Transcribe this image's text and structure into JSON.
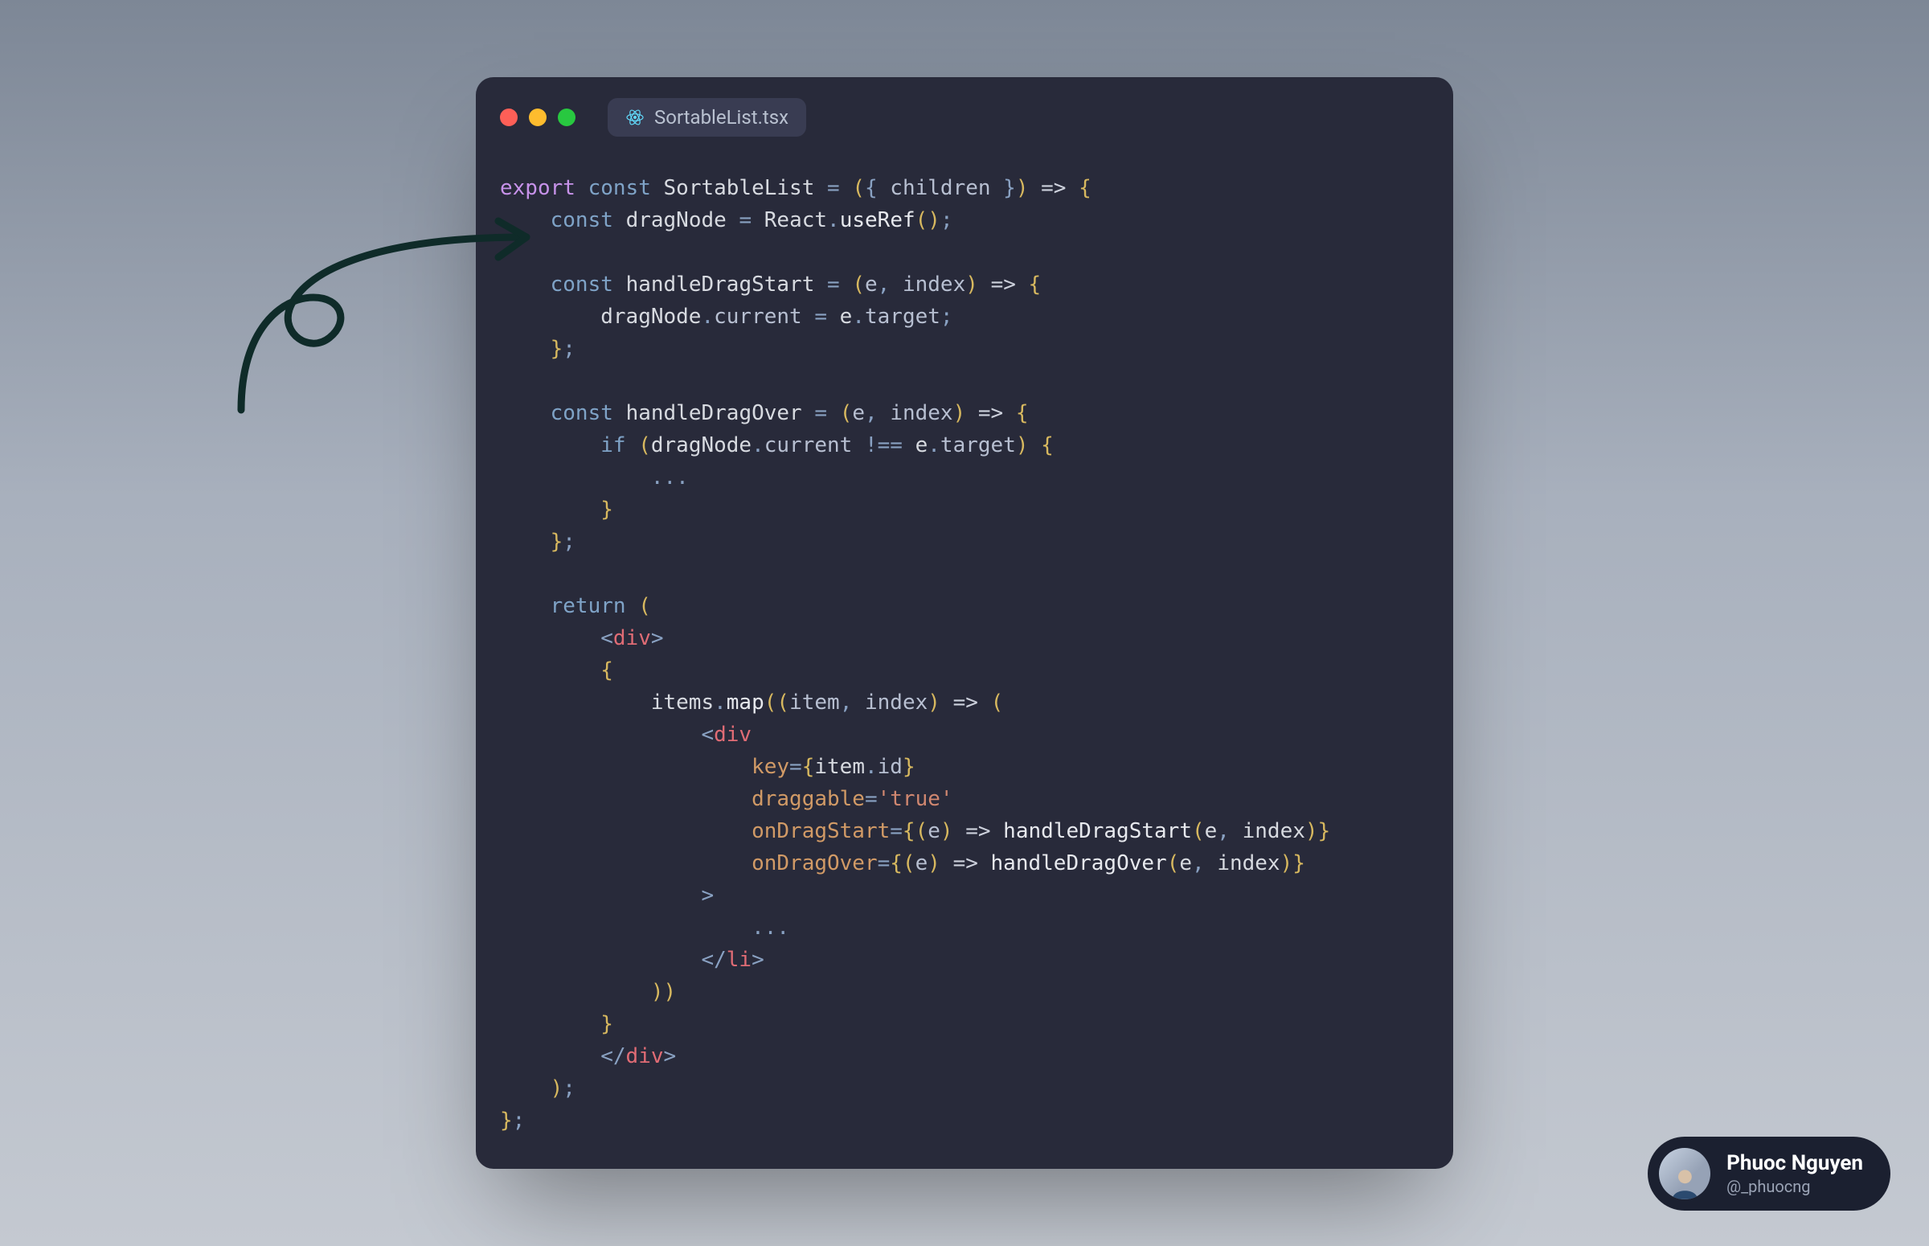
{
  "window": {
    "tab": {
      "label": "SortableList.tsx",
      "icon": "react-icon"
    }
  },
  "code": {
    "tokens": [
      [
        [
          "k1",
          "export"
        ],
        [
          "",
          " "
        ],
        [
          "k2",
          "const"
        ],
        [
          "",
          " "
        ],
        [
          "nm",
          "SortableList"
        ],
        [
          "",
          " "
        ],
        [
          "pn",
          "="
        ],
        [
          "",
          " "
        ],
        [
          "pr",
          "("
        ],
        [
          "pn",
          "{ "
        ],
        [
          "pp",
          "children"
        ],
        [
          "pn",
          " }"
        ],
        [
          "pr",
          ")"
        ],
        [
          "",
          " "
        ],
        [
          "ar",
          "=>"
        ],
        [
          "",
          " "
        ],
        [
          "pr",
          "{"
        ]
      ],
      [
        [
          "",
          "    "
        ],
        [
          "k2",
          "const"
        ],
        [
          "",
          " "
        ],
        [
          "nm",
          "dragNode"
        ],
        [
          "",
          " "
        ],
        [
          "pn",
          "="
        ],
        [
          "",
          " "
        ],
        [
          "nm",
          "React"
        ],
        [
          "pn",
          "."
        ],
        [
          "fn",
          "useRef"
        ],
        [
          "pr",
          "()"
        ],
        [
          "pn",
          ";"
        ]
      ],
      [
        [
          "",
          ""
        ]
      ],
      [
        [
          "",
          "    "
        ],
        [
          "k2",
          "const"
        ],
        [
          "",
          " "
        ],
        [
          "nm",
          "handleDragStart"
        ],
        [
          "",
          " "
        ],
        [
          "pn",
          "="
        ],
        [
          "",
          " "
        ],
        [
          "pr",
          "("
        ],
        [
          "pp",
          "e"
        ],
        [
          "pn",
          ", "
        ],
        [
          "pp",
          "index"
        ],
        [
          "pr",
          ")"
        ],
        [
          "",
          " "
        ],
        [
          "ar",
          "=>"
        ],
        [
          "",
          " "
        ],
        [
          "pr",
          "{"
        ]
      ],
      [
        [
          "",
          "        "
        ],
        [
          "nm",
          "dragNode"
        ],
        [
          "pn",
          "."
        ],
        [
          "pp",
          "current"
        ],
        [
          "",
          " "
        ],
        [
          "pn",
          "="
        ],
        [
          "",
          " "
        ],
        [
          "nm",
          "e"
        ],
        [
          "pn",
          "."
        ],
        [
          "pp",
          "target"
        ],
        [
          "pn",
          ";"
        ]
      ],
      [
        [
          "",
          "    "
        ],
        [
          "pr",
          "}"
        ],
        [
          "pn",
          ";"
        ]
      ],
      [
        [
          "",
          ""
        ]
      ],
      [
        [
          "",
          "    "
        ],
        [
          "k2",
          "const"
        ],
        [
          "",
          " "
        ],
        [
          "nm",
          "handleDragOver"
        ],
        [
          "",
          " "
        ],
        [
          "pn",
          "="
        ],
        [
          "",
          " "
        ],
        [
          "pr",
          "("
        ],
        [
          "pp",
          "e"
        ],
        [
          "pn",
          ", "
        ],
        [
          "pp",
          "index"
        ],
        [
          "pr",
          ")"
        ],
        [
          "",
          " "
        ],
        [
          "ar",
          "=>"
        ],
        [
          "",
          " "
        ],
        [
          "pr",
          "{"
        ]
      ],
      [
        [
          "",
          "        "
        ],
        [
          "k2",
          "if"
        ],
        [
          "",
          " "
        ],
        [
          "pr",
          "("
        ],
        [
          "nm",
          "dragNode"
        ],
        [
          "pn",
          "."
        ],
        [
          "pp",
          "current"
        ],
        [
          "",
          " "
        ],
        [
          "pn",
          "!=="
        ],
        [
          "",
          " "
        ],
        [
          "nm",
          "e"
        ],
        [
          "pn",
          "."
        ],
        [
          "pp",
          "target"
        ],
        [
          "pr",
          ")"
        ],
        [
          "",
          " "
        ],
        [
          "pr",
          "{"
        ]
      ],
      [
        [
          "",
          "            "
        ],
        [
          "pn",
          "..."
        ]
      ],
      [
        [
          "",
          "        "
        ],
        [
          "pr",
          "}"
        ]
      ],
      [
        [
          "",
          "    "
        ],
        [
          "pr",
          "}"
        ],
        [
          "pn",
          ";"
        ]
      ],
      [
        [
          "",
          ""
        ]
      ],
      [
        [
          "",
          "    "
        ],
        [
          "k2",
          "return"
        ],
        [
          "",
          " "
        ],
        [
          "pr",
          "("
        ]
      ],
      [
        [
          "",
          "        "
        ],
        [
          "pn",
          "<"
        ],
        [
          "tg",
          "div"
        ],
        [
          "pn",
          ">"
        ]
      ],
      [
        [
          "",
          "        "
        ],
        [
          "pr",
          "{"
        ]
      ],
      [
        [
          "",
          "            "
        ],
        [
          "nm",
          "items"
        ],
        [
          "pn",
          "."
        ],
        [
          "fn",
          "map"
        ],
        [
          "pr",
          "(("
        ],
        [
          "pp",
          "item"
        ],
        [
          "pn",
          ", "
        ],
        [
          "pp",
          "index"
        ],
        [
          "pr",
          ")"
        ],
        [
          "",
          " "
        ],
        [
          "ar",
          "=>"
        ],
        [
          "",
          " "
        ],
        [
          "pr",
          "("
        ]
      ],
      [
        [
          "",
          "                "
        ],
        [
          "pn",
          "<"
        ],
        [
          "tg",
          "div"
        ]
      ],
      [
        [
          "",
          "                    "
        ],
        [
          "at",
          "key"
        ],
        [
          "pn",
          "="
        ],
        [
          "pr",
          "{"
        ],
        [
          "nm",
          "item"
        ],
        [
          "pn",
          "."
        ],
        [
          "pp",
          "id"
        ],
        [
          "pr",
          "}"
        ]
      ],
      [
        [
          "",
          "                    "
        ],
        [
          "at",
          "draggable"
        ],
        [
          "pn",
          "="
        ],
        [
          "st",
          "'true'"
        ]
      ],
      [
        [
          "",
          "                    "
        ],
        [
          "at",
          "onDragStart"
        ],
        [
          "pn",
          "="
        ],
        [
          "pr",
          "{("
        ],
        [
          "pp",
          "e"
        ],
        [
          "pr",
          ")"
        ],
        [
          "",
          " "
        ],
        [
          "ar",
          "=>"
        ],
        [
          "",
          " "
        ],
        [
          "fn",
          "handleDragStart"
        ],
        [
          "pr",
          "("
        ],
        [
          "nm",
          "e"
        ],
        [
          "pn",
          ", "
        ],
        [
          "nm",
          "index"
        ],
        [
          "pr",
          ")}"
        ]
      ],
      [
        [
          "",
          "                    "
        ],
        [
          "at",
          "onDragOver"
        ],
        [
          "pn",
          "="
        ],
        [
          "pr",
          "{("
        ],
        [
          "pp",
          "e"
        ],
        [
          "pr",
          ")"
        ],
        [
          "",
          " "
        ],
        [
          "ar",
          "=>"
        ],
        [
          "",
          " "
        ],
        [
          "fn",
          "handleDragOver"
        ],
        [
          "pr",
          "("
        ],
        [
          "nm",
          "e"
        ],
        [
          "pn",
          ", "
        ],
        [
          "nm",
          "index"
        ],
        [
          "pr",
          ")}"
        ]
      ],
      [
        [
          "",
          "                "
        ],
        [
          "pn",
          ">"
        ]
      ],
      [
        [
          "",
          "                    "
        ],
        [
          "pn",
          "..."
        ]
      ],
      [
        [
          "",
          "                "
        ],
        [
          "pn",
          "</"
        ],
        [
          "tg",
          "li"
        ],
        [
          "pn",
          ">"
        ]
      ],
      [
        [
          "",
          "            "
        ],
        [
          "pr",
          "))"
        ]
      ],
      [
        [
          "",
          "        "
        ],
        [
          "pr",
          "}"
        ]
      ],
      [
        [
          "",
          "        "
        ],
        [
          "pn",
          "</"
        ],
        [
          "tg",
          "div"
        ],
        [
          "pn",
          ">"
        ]
      ],
      [
        [
          "",
          "    "
        ],
        [
          "pr",
          ")"
        ],
        [
          "pn",
          ";"
        ]
      ],
      [
        [
          "pr",
          "}"
        ],
        [
          "pn",
          ";"
        ]
      ]
    ]
  },
  "badge": {
    "name": "Phuoc Nguyen",
    "handle": "@_phuocng"
  }
}
